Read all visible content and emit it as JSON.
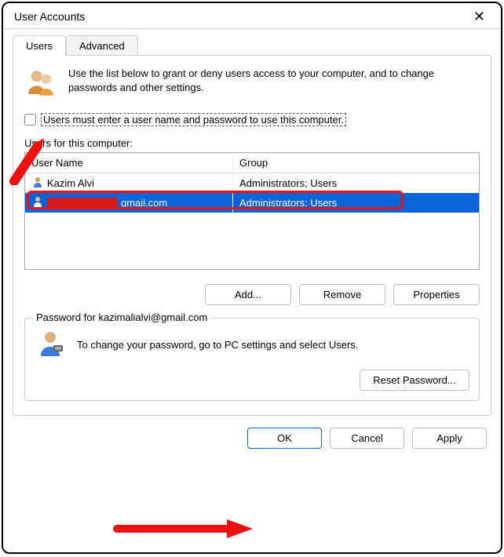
{
  "window": {
    "title": "User Accounts"
  },
  "tabs": [
    {
      "label": "Users",
      "active": true
    },
    {
      "label": "Advanced",
      "active": false
    }
  ],
  "intro_text": "Use the list below to grant or deny users access to your computer, and to change passwords and other settings.",
  "checkbox": {
    "checked": false,
    "label": "Users must enter a user name and password to use this computer."
  },
  "users_section_label": "Users for this computer:",
  "columns": {
    "name": "User Name",
    "group": "Group"
  },
  "users": [
    {
      "name": "Kazim Alvi",
      "group": "Administrators; Users",
      "selected": false,
      "redacted": false,
      "suffix": ""
    },
    {
      "name": "",
      "group": "Administrators; Users",
      "selected": true,
      "redacted": true,
      "suffix": "gmail.com"
    }
  ],
  "buttons": {
    "add": "Add...",
    "remove": "Remove",
    "properties": "Properties"
  },
  "password_section": {
    "legend": "Password for kazimalialvi@gmail.com",
    "text": "To change your password, go to PC settings and select Users.",
    "reset": "Reset Password..."
  },
  "dialog_buttons": {
    "ok": "OK",
    "cancel": "Cancel",
    "apply": "Apply"
  }
}
